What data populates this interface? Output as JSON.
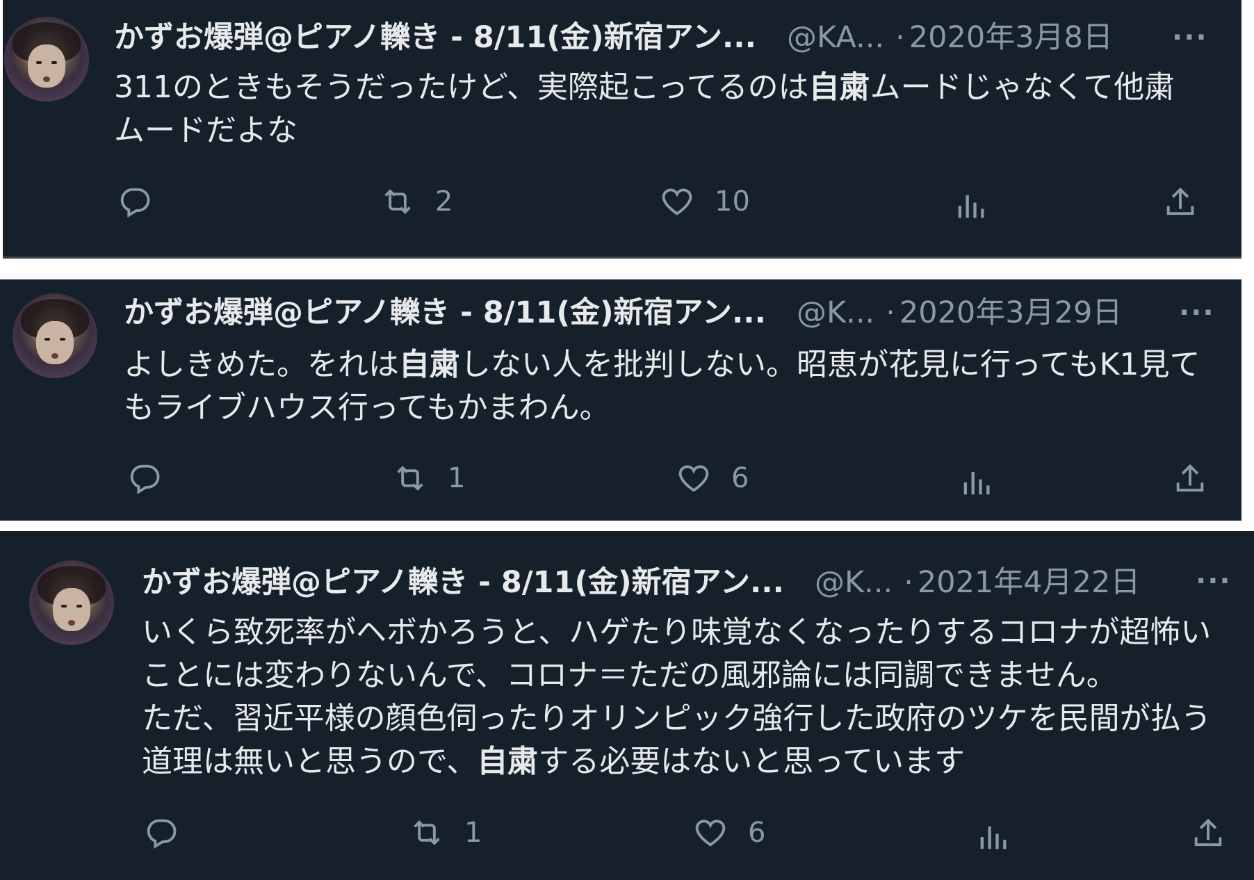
{
  "tweets": [
    {
      "display_name": "かずお爆弾@ピアノ轢き - 8/11(金)新宿アン...",
      "handle": "@KA...",
      "separator": "·",
      "date": "2020年3月8日",
      "more_label": "···",
      "text_parts": [
        "311のときもそうだったけど、実際起こってるのは",
        "自粛",
        "ムードじゃなくて他粛ムードだよな"
      ],
      "replies": "",
      "retweets": "2",
      "likes": "10",
      "icons": [
        "reply-icon",
        "retweet-icon",
        "like-icon",
        "views-icon",
        "share-icon"
      ]
    },
    {
      "display_name": "かずお爆弾@ピアノ轢き - 8/11(金)新宿アン...",
      "handle": "@K...",
      "separator": "·",
      "date": "2020年3月29日",
      "more_label": "···",
      "text_parts": [
        "よしきめた。をれは",
        "自粛",
        "しない人を批判しない。昭恵が花見に行ってもK1見てもライブハウス行ってもかまわん。"
      ],
      "replies": "",
      "retweets": "1",
      "likes": "6",
      "icons": [
        "reply-icon",
        "retweet-icon",
        "like-icon",
        "views-icon",
        "share-icon"
      ]
    },
    {
      "display_name": "かずお爆弾@ピアノ轢き - 8/11(金)新宿アン...",
      "handle": "@K...",
      "separator": "·",
      "date": "2021年4月22日",
      "more_label": "···",
      "text_parts": [
        "いくら致死率がヘボかろうと、ハゲたり味覚なくなったりするコロナが超怖いことには変わりないんで、コロナ＝ただの風邪論には同調できません。\nただ、習近平様の顔色伺ったりオリンピック強行した政府のツケを民間が払う道理は無いと思うので、",
        "自粛",
        "する必要はないと思っています"
      ],
      "replies": "",
      "retweets": "1",
      "likes": "6",
      "icons": [
        "reply-icon",
        "retweet-icon",
        "like-icon",
        "views-icon",
        "share-icon"
      ]
    }
  ],
  "colors": {
    "background": "#15202b",
    "text": "#e7e9ea",
    "secondary": "#8b98a5",
    "divider": "#38444d"
  }
}
